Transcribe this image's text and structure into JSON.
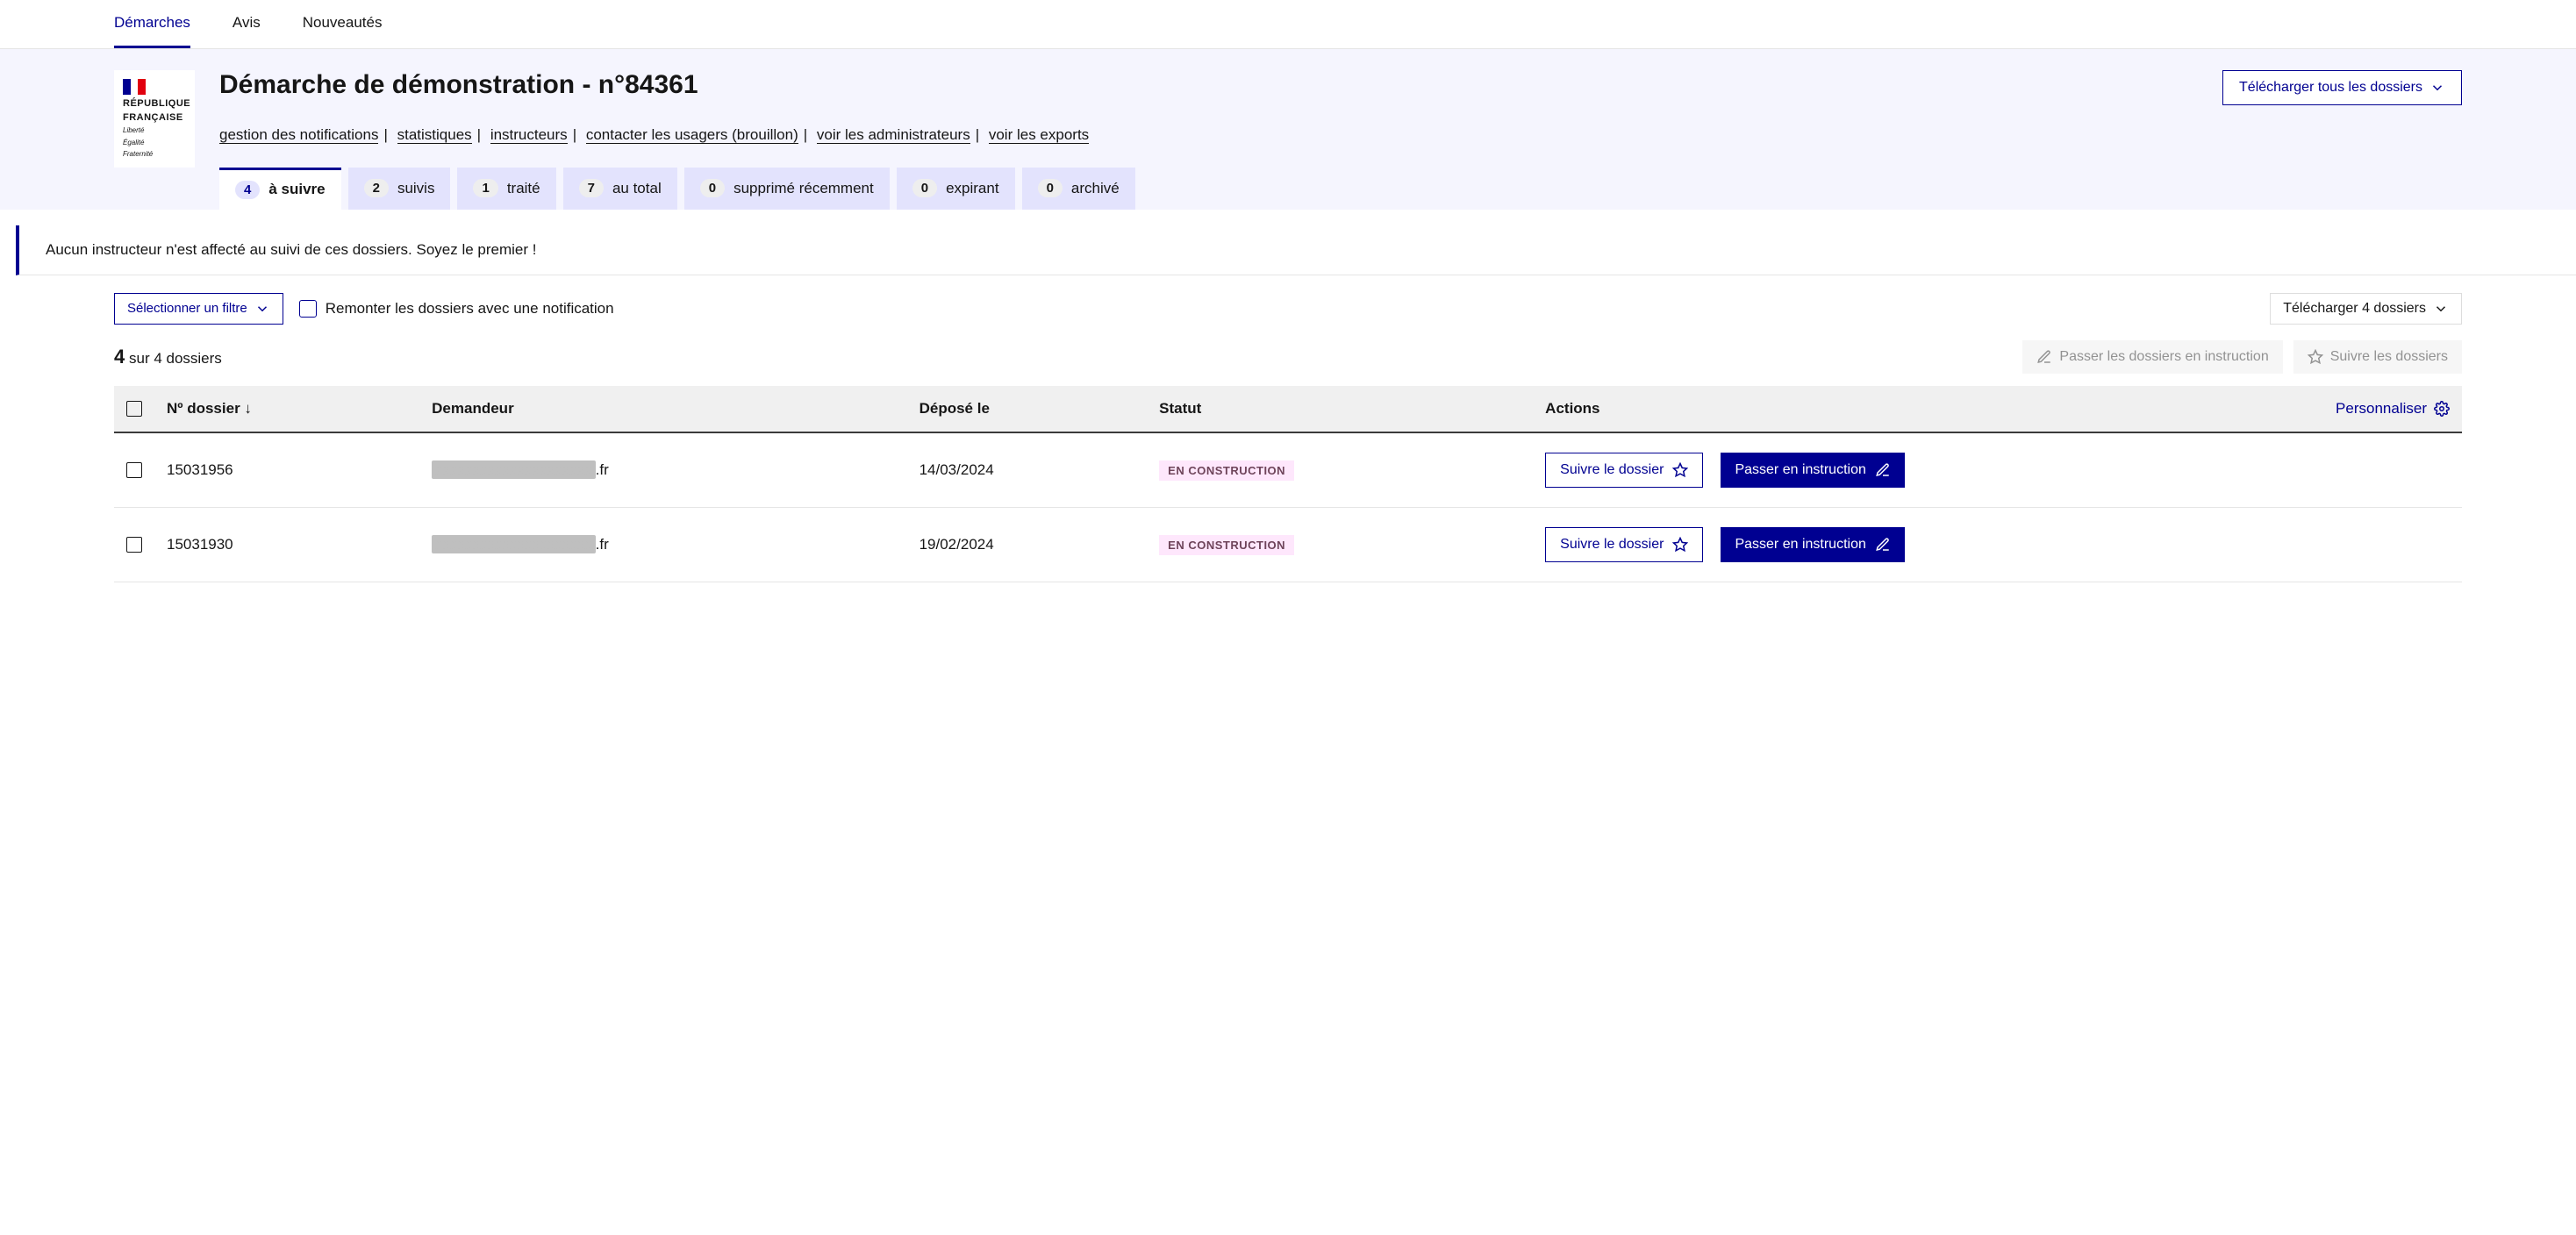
{
  "topNav": [
    {
      "label": "Démarches",
      "active": true
    },
    {
      "label": "Avis",
      "active": false
    },
    {
      "label": "Nouveautés",
      "active": false
    }
  ],
  "logo": {
    "line1": "RÉPUBLIQUE",
    "line2": "FRANÇAISE",
    "motto1": "Liberté",
    "motto2": "Égalité",
    "motto3": "Fraternité"
  },
  "pageTitle": "Démarche de démonstration - n°84361",
  "downloadAll": "Télécharger tous les dossiers",
  "links": [
    "gestion des notifications",
    "statistiques",
    "instructeurs",
    "contacter les usagers (brouillon)",
    "voir les administrateurs",
    "voir les exports"
  ],
  "tabs": [
    {
      "count": "4",
      "label": "à suivre",
      "active": true
    },
    {
      "count": "2",
      "label": "suivis",
      "active": false
    },
    {
      "count": "1",
      "label": "traité",
      "active": false
    },
    {
      "count": "7",
      "label": "au total",
      "active": false
    },
    {
      "count": "0",
      "label": "supprimé récemment",
      "active": false
    },
    {
      "count": "0",
      "label": "expirant",
      "active": false
    },
    {
      "count": "0",
      "label": "archivé",
      "active": false
    }
  ],
  "notice": "Aucun instructeur n'est affecté au suivi de ces dossiers. Soyez le premier !",
  "filterSelect": "Sélectionner un filtre",
  "notifCheckbox": "Remonter les dossiers avec une notification",
  "downloadN": "Télécharger 4 dossiers",
  "countBig": "4",
  "countRest": "sur 4 dossiers",
  "bulkInstruction": "Passer les dossiers en instruction",
  "bulkFollow": "Suivre les dossiers",
  "columns": {
    "numero": "Nº dossier ↓",
    "demandeur": "Demandeur",
    "depose": "Déposé le",
    "statut": "Statut",
    "actions": "Actions",
    "personnaliser": "Personnaliser"
  },
  "rows": [
    {
      "numero": "15031956",
      "demandeurHidden": "xxxxxxxxxxxxxxxxxxxxx",
      "demandeurSuffix": ".fr",
      "depose": "14/03/2024",
      "statut": "EN CONSTRUCTION"
    },
    {
      "numero": "15031930",
      "demandeurHidden": "xxxxxxxxxxxxxxxxxxxxx",
      "demandeurSuffix": ".fr",
      "depose": "19/02/2024",
      "statut": "EN CONSTRUCTION"
    }
  ],
  "btnFollow": "Suivre le dossier",
  "btnInstruct": "Passer en instruction"
}
